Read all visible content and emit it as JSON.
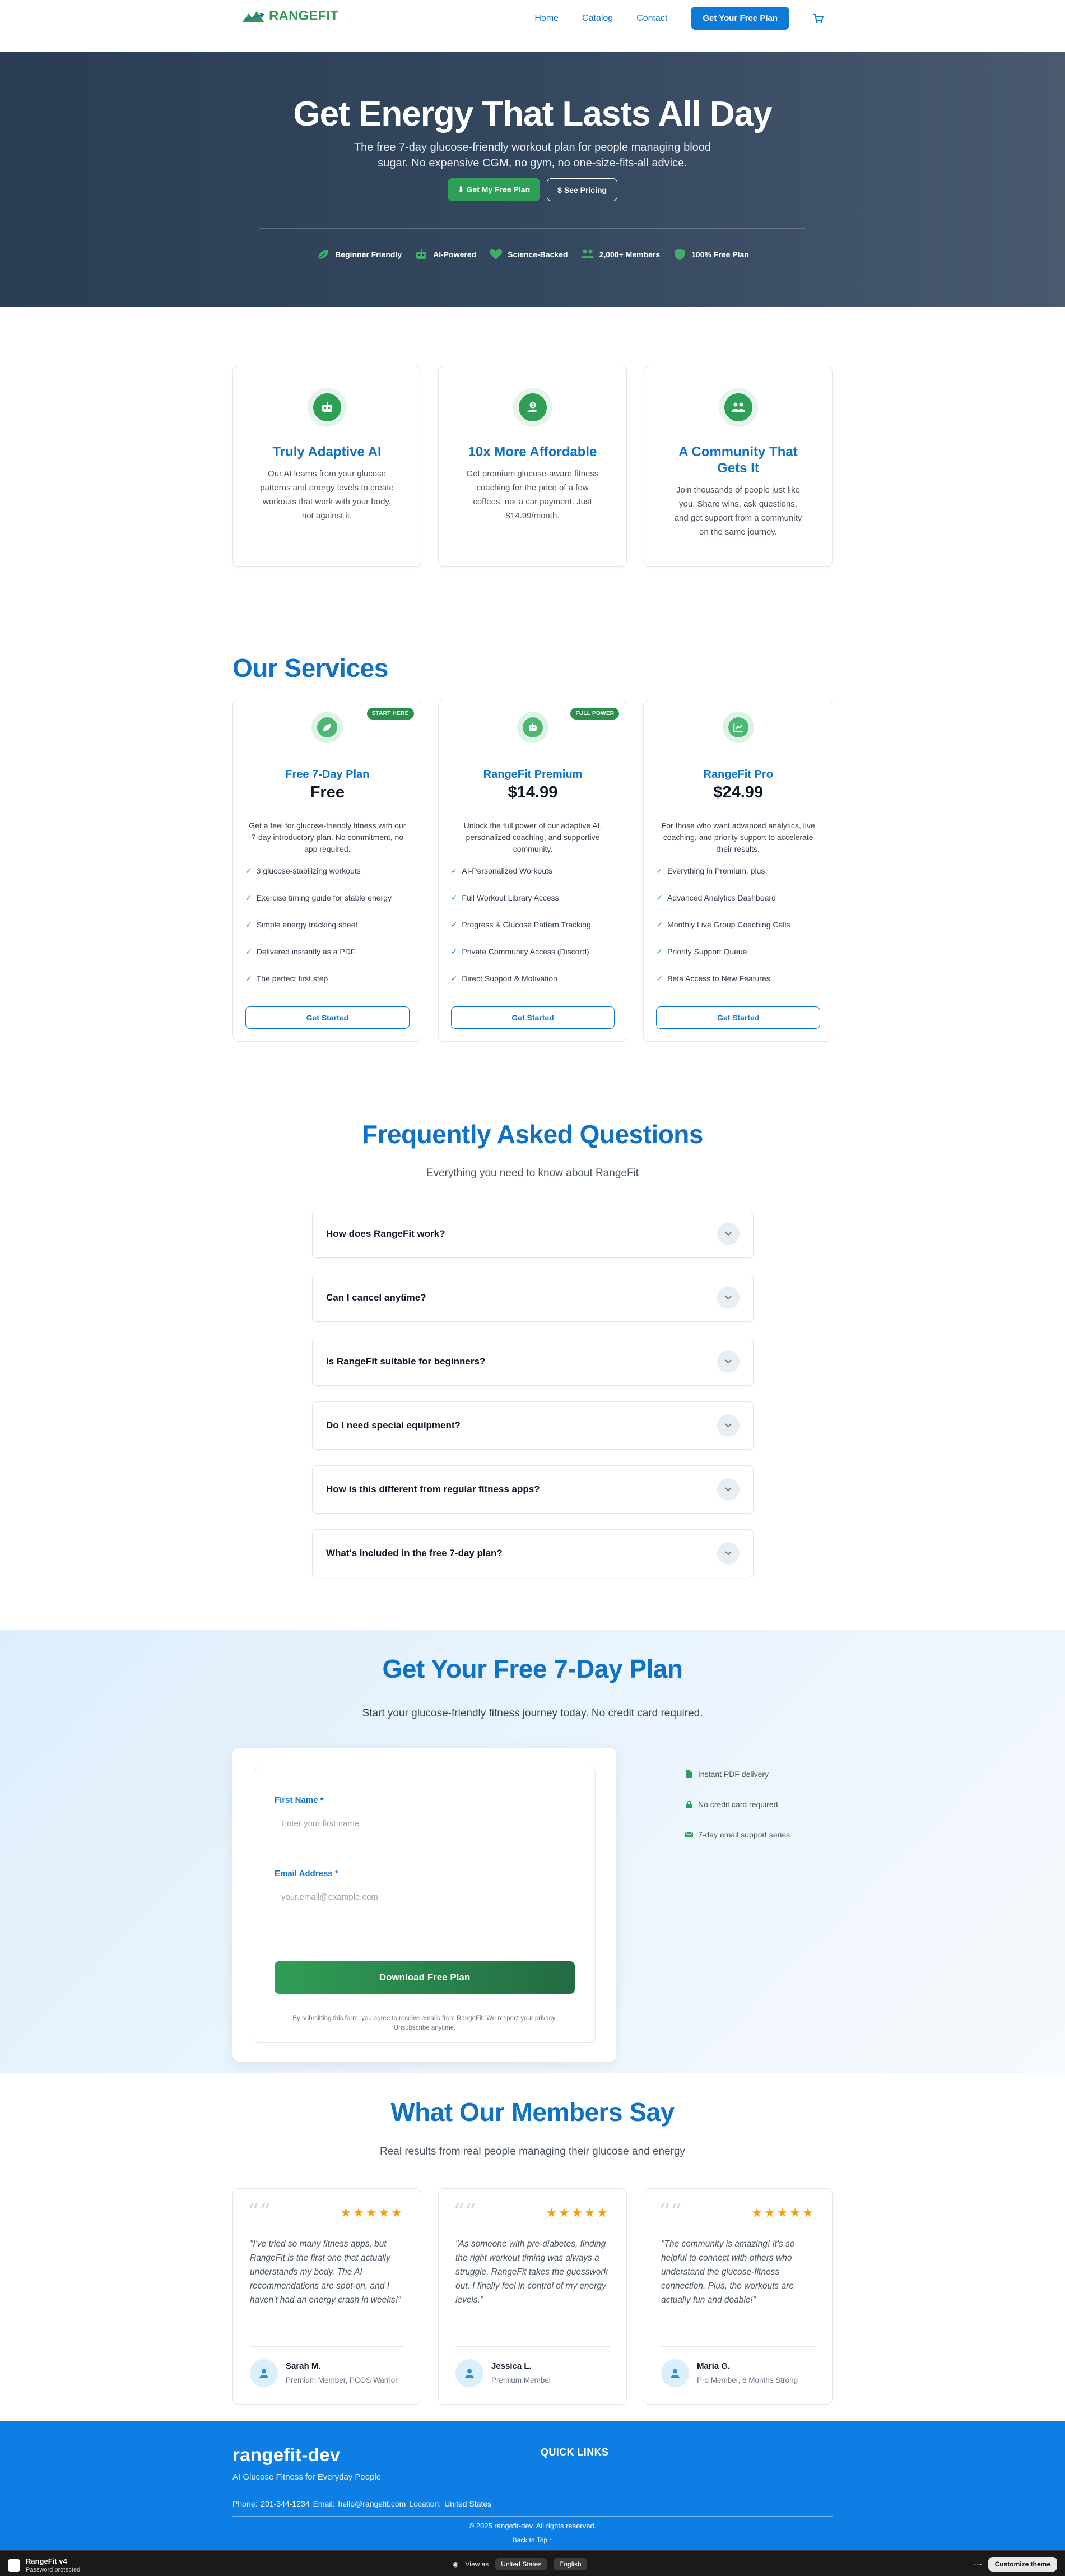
{
  "header": {
    "logo_text": "RANGEFIT",
    "nav": [
      "Home",
      "Catalog",
      "Contact"
    ],
    "cta": "Get Your Free Plan"
  },
  "hero": {
    "title": "Get Energy That Lasts All Day",
    "subtitle": "The free 7-day glucose-friendly workout plan for people managing blood sugar. No expensive CGM, no gym, no one-size-fits-all advice.",
    "primary_btn": "⬇ Get My Free Plan",
    "secondary_btn": "$ See Pricing",
    "badges": [
      {
        "label": "Beginner Friendly",
        "icon": "leaf-icon"
      },
      {
        "label": "AI-Powered",
        "icon": "robot-icon"
      },
      {
        "label": "Science-Backed",
        "icon": "heart-icon"
      },
      {
        "label": "2,000+ Members",
        "icon": "users-icon"
      },
      {
        "label": "100% Free Plan",
        "icon": "shield-icon"
      }
    ]
  },
  "features": [
    {
      "title": "Truly Adaptive AI",
      "text": "Our AI learns from your glucose patterns and energy levels to create workouts that work with your body, not against it.",
      "icon": "robot-icon"
    },
    {
      "title": "10x More Affordable",
      "text": "Get premium glucose-aware fitness coaching for the price of a few coffees, not a car payment. Just $14.99/month.",
      "icon": "hand-dollar-icon"
    },
    {
      "title": "A Community That Gets It",
      "text": "Join thousands of people just like you. Share wins, ask questions, and get support from a community on the same journey.",
      "icon": "users-icon"
    }
  ],
  "services": {
    "title": "Our Services",
    "plans": [
      {
        "tag": "START HERE",
        "name": "Free 7-Day Plan",
        "price": "Free",
        "icon": "leaf-icon",
        "desc": "Get a feel for glucose-friendly fitness with our 7-day introductory plan. No commitment, no app required.",
        "features": [
          "3 glucose-stabilizing workouts",
          "Exercise timing guide for stable energy",
          "Simple energy tracking sheet",
          "Delivered instantly as a PDF",
          "The perfect first step"
        ],
        "button": "Get Started"
      },
      {
        "tag": "FULL POWER",
        "name": "RangeFit Premium",
        "price": "$14.99",
        "icon": "robot-icon",
        "desc": "Unlock the full power of our adaptive AI, personalized coaching, and supportive community.",
        "features": [
          "AI-Personalized Workouts",
          "Full Workout Library Access",
          "Progress & Glucose Pattern Tracking",
          "Private Community Access (Discord)",
          "Direct Support & Motivation"
        ],
        "button": "Get Started"
      },
      {
        "tag": "",
        "name": "RangeFit Pro",
        "price": "$24.99",
        "icon": "chart-line-icon",
        "desc": "For those who want advanced analytics, live coaching, and priority support to accelerate their results.",
        "features": [
          "Everything in Premium, plus:",
          "Advanced Analytics Dashboard",
          "Monthly Live Group Coaching Calls",
          "Priority Support Queue",
          "Beta Access to New Features"
        ],
        "button": "Get Started"
      }
    ],
    "check": "✓"
  },
  "faq": {
    "title": "Frequently Asked Questions",
    "subtitle": "Everything you need to know about RangeFit",
    "questions": [
      "How does RangeFit work?",
      "Can I cancel anytime?",
      "Is RangeFit suitable for beginners?",
      "Do I need special equipment?",
      "How is this different from regular fitness apps?",
      "What's included in the free 7-day plan?"
    ]
  },
  "freeplan": {
    "title": "Get Your Free 7-Day Plan",
    "subtitle": "Start your glucose-friendly fitness journey today. No credit card required.",
    "first_name_label": "First Name *",
    "first_name_placeholder": "Enter your first name",
    "email_label": "Email Address *",
    "email_placeholder": "your.email@example.com",
    "button": "Download Free Plan",
    "note": "By submitting this form, you agree to receive emails from RangeFit. We respect your privacy. Unsubscribe anytime.",
    "perks": [
      {
        "label": "Instant PDF delivery",
        "icon": "pdf-icon"
      },
      {
        "label": "No credit card required",
        "icon": "lock-icon"
      },
      {
        "label": "7-day email support series",
        "icon": "email-icon"
      }
    ]
  },
  "testimonials": {
    "title": "What Our Members Say",
    "subtitle": "Real results from real people managing their glucose and energy",
    "stars": "★★★★★",
    "items": [
      {
        "text": "\"I've tried so many fitness apps, but RangeFit is the first one that actually understands my body. The AI recommendations are spot-on, and I haven't had an energy crash in weeks!\"",
        "name": "Sarah M.",
        "role": "Premium Member, PCOS Warrior"
      },
      {
        "text": "\"As someone with pre-diabetes, finding the right workout timing was always a struggle. RangeFit takes the guesswork out. I finally feel in control of my energy levels.\"",
        "name": "Jessica L.",
        "role": "Premium Member"
      },
      {
        "text": "\"The community is amazing! It's so helpful to connect with others who understand the glucose-fitness connection. Plus, the workouts are actually fun and doable!\"",
        "name": "Maria G.",
        "role": "Pro Member, 6 Months Strong"
      }
    ]
  },
  "footer": {
    "brand": "rangefit-dev",
    "tagline": "AI Glucose Fitness for Everyday People",
    "quick_links": "QUICK LINKS",
    "phone_label": "Phone:",
    "phone": "201-344-1234",
    "email_label": "Email:",
    "email": "hello@rangefit.com",
    "location_label": "Location:",
    "location": "United States",
    "copyright": "© 2025 rangefit-dev. All rights reserved.",
    "back_to_top": "Back to Top ↑"
  },
  "preview_bar": {
    "store_name": "RangeFit v4",
    "status": "Password protected",
    "view_as": "View as",
    "country": "United States",
    "language": "English",
    "customize": "Customize theme"
  },
  "colors": {
    "brand_blue": "#0f72c9",
    "brand_green": "#2f9e56",
    "hero_bg": "#2a3d55",
    "footer_bg": "#0d7fe4"
  }
}
